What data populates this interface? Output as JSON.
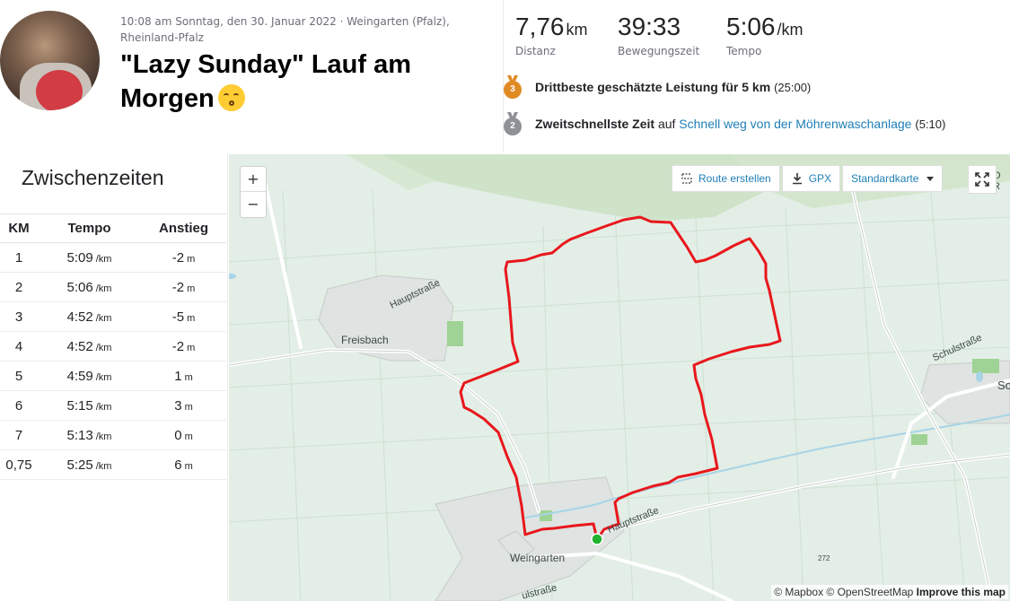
{
  "activity": {
    "meta": "10:08 am Sonntag, den 30. Januar 2022 · Weingarten (Pfalz), Rheinland-Pfalz",
    "title": "\"Lazy Sunday\" Lauf am Morgen",
    "emoji_icon": "kissing-face-emoji-icon"
  },
  "stats": [
    {
      "value": "7,76",
      "unit": "km",
      "label": "Distanz"
    },
    {
      "value": "39:33",
      "unit": "",
      "label": "Bewegungszeit"
    },
    {
      "value": "5:06",
      "unit": "/km",
      "label": "Tempo"
    }
  ],
  "achievements": [
    {
      "medal": "3",
      "medal_color": "#e08a24",
      "strong": "Drittbeste geschätzte Leistung für 5 km",
      "pre_link": "",
      "link": "",
      "suffix": "(25:00)"
    },
    {
      "medal": "2",
      "medal_color": "#8f9196",
      "strong": "Zweitschnellste Zeit",
      "pre_link": "auf",
      "link": "Schnell weg von der Möhrenwaschanlage",
      "suffix": "(5:10)"
    }
  ],
  "splits": {
    "title": "Zwischenzeiten",
    "headers": {
      "km": "KM",
      "pace": "Tempo",
      "elev": "Anstieg"
    },
    "pace_unit": "/km",
    "elev_unit": "m",
    "rows": [
      {
        "km": "1",
        "pace": "5:09",
        "elev": "-2"
      },
      {
        "km": "2",
        "pace": "5:06",
        "elev": "-2"
      },
      {
        "km": "3",
        "pace": "4:52",
        "elev": "-5"
      },
      {
        "km": "4",
        "pace": "4:52",
        "elev": "-2"
      },
      {
        "km": "5",
        "pace": "4:59",
        "elev": "1"
      },
      {
        "km": "6",
        "pace": "5:15",
        "elev": "3"
      },
      {
        "km": "7",
        "pace": "5:13",
        "elev": "0"
      },
      {
        "km": "0,75",
        "pace": "5:25",
        "elev": "6"
      }
    ]
  },
  "map": {
    "zoom_in": "+",
    "zoom_out": "−",
    "route_button": "Route erstellen",
    "gpx_button": "GPX",
    "map_type": "Standardkarte",
    "labels": {
      "hauptstrasse_1": "Hauptstraße",
      "freisbach": "Freisbach",
      "schulstrasse": "Schulstraße",
      "so": "So",
      "o_r": "O R",
      "hauptstrasse_2": "Hauptstraße",
      "weingarten": "Weingarten",
      "road_272": "272",
      "ulstrasse": "ulstraße"
    },
    "attribution": "© Mapbox © OpenStreetMap",
    "improve": "Improve this map",
    "route_color": "#e8171c",
    "start_color": "#1fb330"
  }
}
